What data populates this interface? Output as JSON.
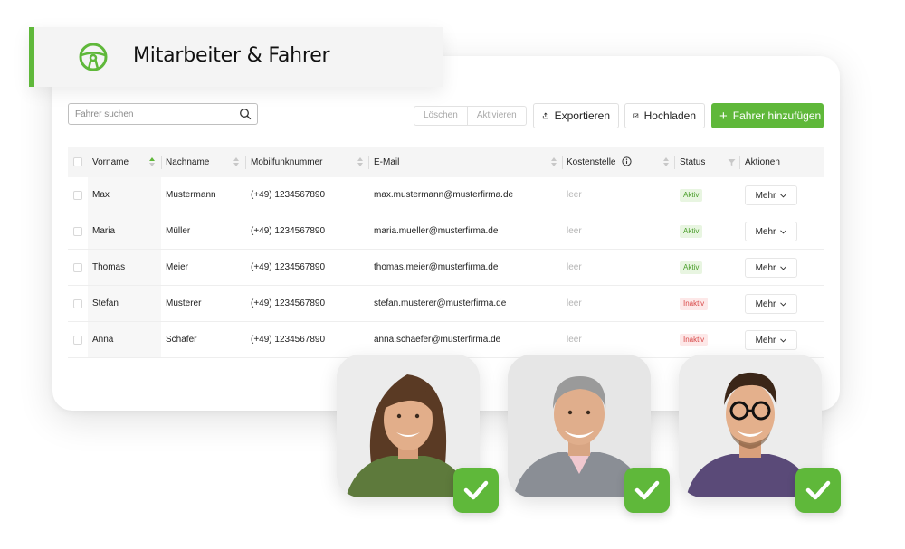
{
  "header": {
    "title": "Mitarbeiter & Fahrer",
    "icon": "steering-wheel-icon",
    "accent": "#5fb83a"
  },
  "toolbar": {
    "search_placeholder": "Fahrer suchen",
    "delete_label": "Löschen",
    "activate_label": "Aktivieren",
    "export_label": "Exportieren",
    "upload_label": "Hochladen",
    "add_label": "Fahrer hinzufügen"
  },
  "table": {
    "headers": {
      "first_name": "Vorname",
      "last_name": "Nachname",
      "mobile": "Mobilfunknummer",
      "email": "E-Mail",
      "cost_center": "Kostenstelle",
      "status": "Status",
      "actions": "Aktionen"
    },
    "rows": [
      {
        "first_name": "Max",
        "last_name": "Mustermann",
        "mobile": "(+49) 1234567890",
        "email": "max.mustermann@musterfirma.de",
        "cost_center": "leer",
        "status": "Aktiv",
        "action": "Mehr"
      },
      {
        "first_name": "Maria",
        "last_name": "Müller",
        "mobile": "(+49) 1234567890",
        "email": "maria.mueller@musterfirma.de",
        "cost_center": "leer",
        "status": "Aktiv",
        "action": "Mehr"
      },
      {
        "first_name": "Thomas",
        "last_name": "Meier",
        "mobile": "(+49) 1234567890",
        "email": "thomas.meier@musterfirma.de",
        "cost_center": "leer",
        "status": "Aktiv",
        "action": "Mehr"
      },
      {
        "first_name": "Stefan",
        "last_name": "Musterer",
        "mobile": "(+49) 1234567890",
        "email": "stefan.musterer@musterfirma.de",
        "cost_center": "leer",
        "status": "Inaktiv",
        "action": "Mehr"
      },
      {
        "first_name": "Anna",
        "last_name": "Schäfer",
        "mobile": "(+49) 1234567890",
        "email": "anna.schaefer@musterfirma.de",
        "cost_center": "leer",
        "status": "Inaktiv",
        "action": "Mehr"
      }
    ]
  },
  "photos": [
    {
      "subject": "woman-smiling",
      "badge": "check-icon"
    },
    {
      "subject": "man-grey-hair-smiling",
      "badge": "check-icon"
    },
    {
      "subject": "man-glasses-smiling",
      "badge": "check-icon"
    }
  ],
  "colors": {
    "accent": "#5fb83a",
    "active_text": "#4a9e2a",
    "inactive_text": "#d84848"
  }
}
